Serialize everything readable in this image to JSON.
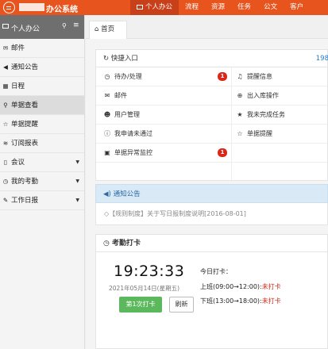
{
  "app": {
    "title": "办公系统"
  },
  "nav": [
    {
      "label": "个人办公",
      "active": true
    },
    {
      "label": "流程"
    },
    {
      "label": "资源"
    },
    {
      "label": "任务"
    },
    {
      "label": "公文"
    },
    {
      "label": "客户"
    }
  ],
  "sidebar": {
    "header": "个人办公",
    "items": [
      {
        "label": "邮件",
        "icon": "envelope-icon",
        "glyph": "✉"
      },
      {
        "label": "通知公告",
        "icon": "speaker-icon",
        "glyph": "◀"
      },
      {
        "label": "日程",
        "icon": "calendar-icon",
        "glyph": "▦"
      },
      {
        "label": "单据查看",
        "icon": "search-icon",
        "glyph": "⚲",
        "active": true
      },
      {
        "label": "单据提醒",
        "icon": "star-icon",
        "glyph": "☆"
      },
      {
        "label": "订阅报表",
        "icon": "rss-icon",
        "glyph": "≋"
      },
      {
        "label": "会议",
        "icon": "bookmark-icon",
        "glyph": "▯",
        "caret": true
      },
      {
        "label": "我的考勤",
        "icon": "clock-icon",
        "glyph": "◷",
        "caret": true
      },
      {
        "label": "工作日报",
        "icon": "edit-icon",
        "glyph": "✎",
        "caret": true
      }
    ]
  },
  "tabs": {
    "home": "首页"
  },
  "quick": {
    "title": "快捷入口",
    "count": "198",
    "rows": [
      {
        "left": "待办/处理",
        "left_icon": "clock-icon",
        "left_glyph": "◷",
        "left_badge": "1",
        "right": "提醒信息",
        "right_icon": "bell-icon",
        "right_glyph": "♫"
      },
      {
        "left": "邮件",
        "left_icon": "envelope-icon",
        "left_glyph": "✉",
        "right": "出入库操作",
        "right_icon": "plus-circle-icon",
        "right_glyph": "⊕"
      },
      {
        "left": "用户管理",
        "left_icon": "user-icon",
        "left_glyph": "☻",
        "right": "我未完成任务",
        "right_icon": "star-icon",
        "right_glyph": "★"
      },
      {
        "left": "我申请未通过",
        "left_icon": "info-icon",
        "left_glyph": "ⓘ",
        "right": "单据提醒",
        "right_icon": "star-outline-icon",
        "right_glyph": "☆"
      },
      {
        "left": "单据异常监控",
        "left_icon": "briefcase-icon",
        "left_glyph": "▣",
        "left_badge": "1"
      }
    ]
  },
  "notice": {
    "title": "通知公告",
    "item": "◇【规则制度】关于写日报制度说明[2016-08-01]"
  },
  "attendance": {
    "title": "考勤打卡",
    "time": "19:23:33",
    "date": "2021年05月14日(星期五)",
    "punch_button": "第1次打卡",
    "refresh_button": "刷新",
    "today_label": "今日打卡：",
    "shifts": [
      {
        "label": "上班(09:00→12:00):",
        "status": "未打卡"
      },
      {
        "label": "下班(13:00→18:00):",
        "status": "未打卡"
      }
    ]
  },
  "colors": {
    "brand": "#e8541e",
    "active_nav": "#c8401a",
    "badge": "#d9281a",
    "punch": "#5cb85c",
    "notice_bg": "#d9e9f6"
  }
}
